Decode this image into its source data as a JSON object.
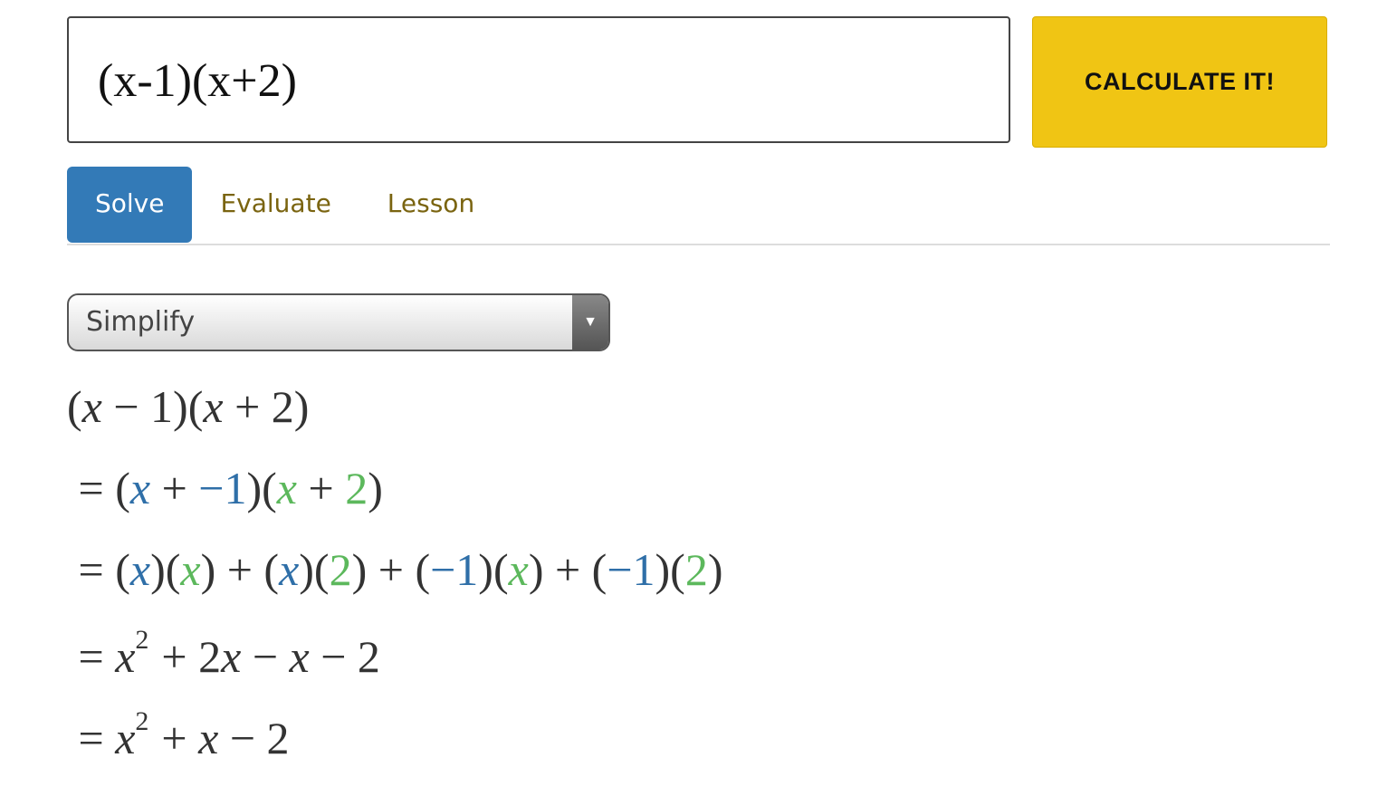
{
  "input": {
    "value": "(x-1)(x+2)"
  },
  "calculate_label": "CALCULATE IT!",
  "tabs": [
    {
      "label": "Solve",
      "active": true
    },
    {
      "label": "Evaluate",
      "active": false
    },
    {
      "label": "Lesson",
      "active": false
    }
  ],
  "select": {
    "value": "Simplify"
  },
  "colors": {
    "blue": "#2f6fa8",
    "green": "#5cb85c",
    "accent": "#337ab7",
    "button": "#f0c514"
  },
  "steps": [
    [
      {
        "t": "("
      },
      {
        "t": "x",
        "i": 1
      },
      {
        "t": " − 1)("
      },
      {
        "t": "x",
        "i": 1
      },
      {
        "t": " + 2)"
      }
    ],
    [
      {
        "t": " = ("
      },
      {
        "t": "x",
        "i": 1,
        "c": "blue"
      },
      {
        "t": " + "
      },
      {
        "t": "−1",
        "c": "blue"
      },
      {
        "t": ")("
      },
      {
        "t": "x",
        "i": 1,
        "c": "green"
      },
      {
        "t": " + "
      },
      {
        "t": "2",
        "c": "green"
      },
      {
        "t": ")"
      }
    ],
    [
      {
        "t": " = ("
      },
      {
        "t": "x",
        "i": 1,
        "c": "blue"
      },
      {
        "t": ")("
      },
      {
        "t": "x",
        "i": 1,
        "c": "green"
      },
      {
        "t": ") + ("
      },
      {
        "t": "x",
        "i": 1,
        "c": "blue"
      },
      {
        "t": ")("
      },
      {
        "t": "2",
        "c": "green"
      },
      {
        "t": ") + ("
      },
      {
        "t": "−1",
        "c": "blue"
      },
      {
        "t": ")("
      },
      {
        "t": "x",
        "i": 1,
        "c": "green"
      },
      {
        "t": ") + ("
      },
      {
        "t": "−1",
        "c": "blue"
      },
      {
        "t": ")("
      },
      {
        "t": "2",
        "c": "green"
      },
      {
        "t": ")"
      }
    ],
    [
      {
        "t": " = "
      },
      {
        "t": "x",
        "i": 1
      },
      {
        "t": "2",
        "sup": 1
      },
      {
        "t": "+ 2"
      },
      {
        "t": "x",
        "i": 1
      },
      {
        "t": " − "
      },
      {
        "t": "x",
        "i": 1
      },
      {
        "t": " − 2"
      }
    ],
    [
      {
        "t": " = "
      },
      {
        "t": "x",
        "i": 1
      },
      {
        "t": "2",
        "sup": 1
      },
      {
        "t": "+ "
      },
      {
        "t": "x",
        "i": 1
      },
      {
        "t": " − 2"
      }
    ]
  ]
}
